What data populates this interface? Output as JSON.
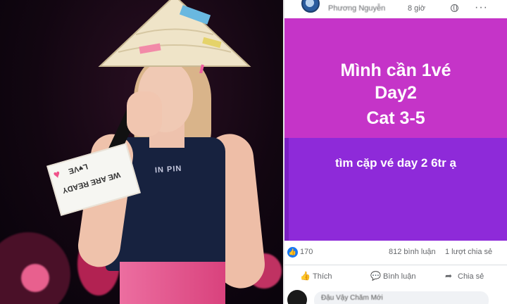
{
  "photo": {
    "banner_line1": "L♥VE",
    "banner_line2": "WE ARE READY",
    "top_text": "IN PIN"
  },
  "post": {
    "author": "Phương Nguyễn",
    "time": "8 giờ",
    "card1_lines": [
      "Mình cần 1vé",
      "Day2",
      "Cat 3-5"
    ],
    "card2_text": "tìm cặp vé day 2 6tr ạ",
    "colors": {
      "card1_bg": "#c534c8",
      "card2_bg": "#8e2ad9",
      "like_blue": "#1877f2"
    },
    "stats": {
      "likes": "170",
      "comments": "812 bình luận",
      "shares": "1 lượt chia sẻ"
    },
    "actions": {
      "like": "Thích",
      "comment": "Bình luận",
      "share": "Chia sẻ"
    },
    "comment_preview": {
      "name": "Đậu Vậy Chăm Mới"
    },
    "icons": {
      "globe": "globe-icon",
      "more": "more-icon",
      "like": "thumbs-up-icon",
      "comment": "comment-icon",
      "share": "share-icon"
    }
  }
}
